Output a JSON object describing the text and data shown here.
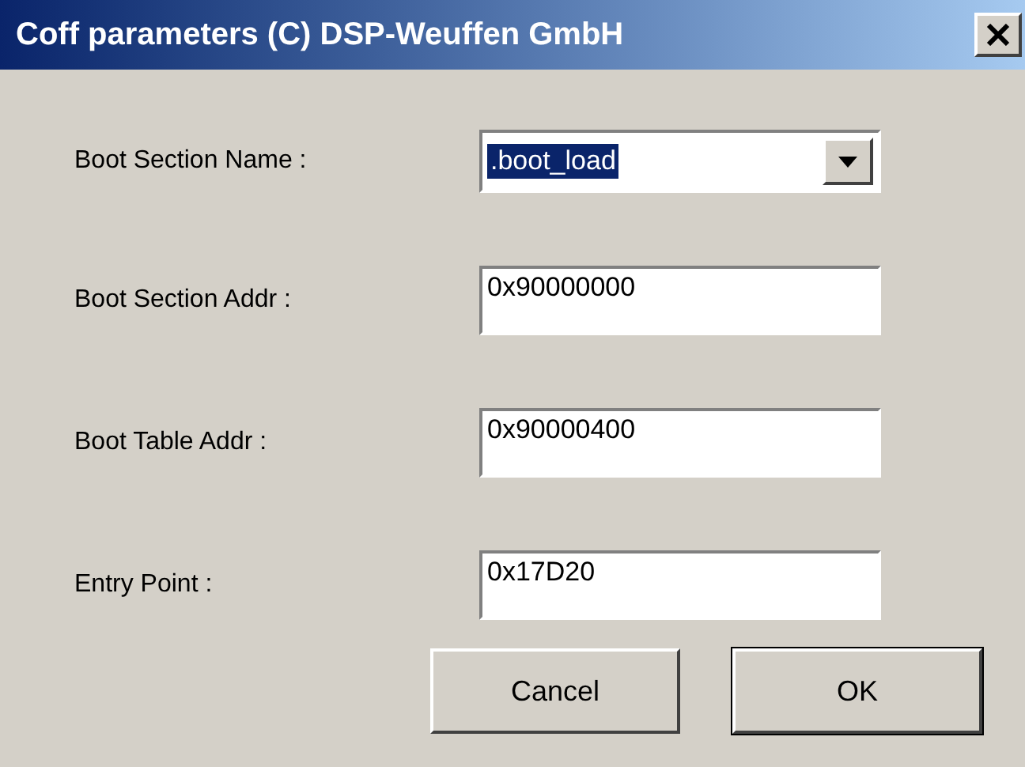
{
  "window": {
    "title": "Coff parameters (C) DSP-Weuffen GmbH"
  },
  "fields": [
    {
      "kind": "dropdown",
      "label": "Boot Section Name :",
      "value": ".boot_load",
      "highlighted": true
    },
    {
      "kind": "text",
      "label": "Boot Section Addr :",
      "value": "0x90000000"
    },
    {
      "kind": "text",
      "label": "Boot Table Addr :",
      "value": "0x90000400"
    },
    {
      "kind": "text",
      "label": "Entry Point :",
      "value": "0x17D20"
    }
  ],
  "buttons": [
    {
      "label": "Cancel",
      "default": false
    },
    {
      "label": "OK",
      "default": true
    }
  ]
}
